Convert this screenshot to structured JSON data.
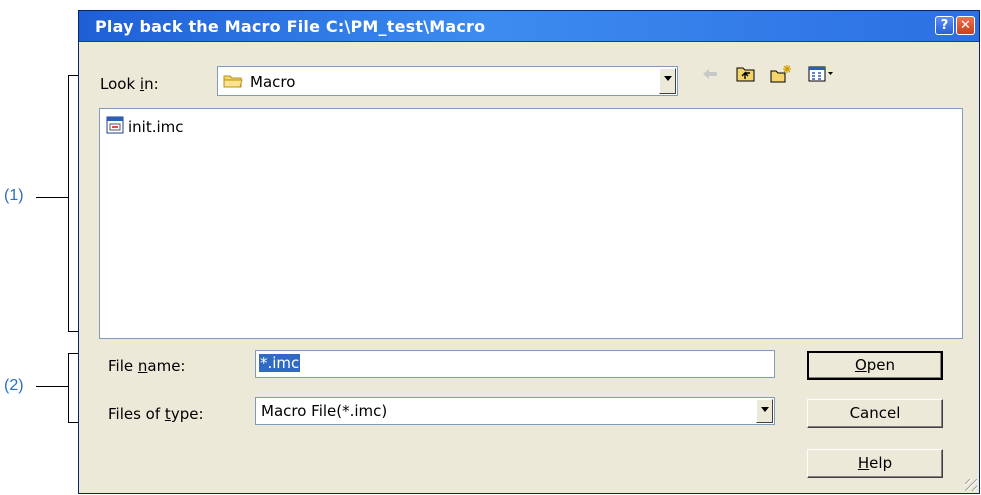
{
  "annotations": {
    "one": "(1)",
    "two": "(2)"
  },
  "window": {
    "title": "Play back the Macro File C:\\PM_test\\Macro",
    "help_glyph": "?",
    "close_glyph": "✕"
  },
  "look_in": {
    "label_pre": "Look ",
    "label_u": "i",
    "label_post": "n:",
    "value": "Macro"
  },
  "toolbar": {
    "icons": [
      "back-arrow-icon",
      "up-folder-icon",
      "new-folder-icon",
      "view-menu-icon"
    ]
  },
  "files": [
    {
      "name": "init.imc",
      "icon": "macro-file-icon"
    }
  ],
  "file_name": {
    "label_pre": "File ",
    "label_u": "n",
    "label_post": "ame:",
    "value": "*.imc"
  },
  "file_type": {
    "label_pre": "Files of ",
    "label_u": "t",
    "label_post": "ype:",
    "value": "Macro File(*.imc)"
  },
  "buttons": {
    "open_u": "O",
    "open_rest": "pen",
    "cancel": "Cancel",
    "help_u": "H",
    "help_rest": "elp"
  }
}
